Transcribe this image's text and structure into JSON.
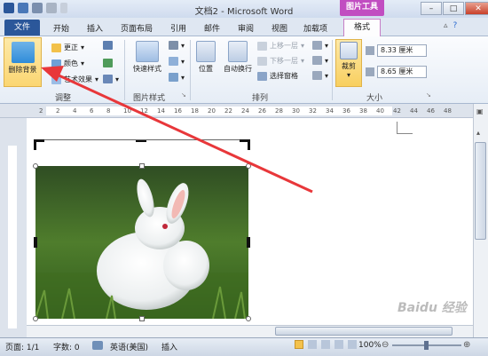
{
  "window": {
    "title": "文档2 - Microsoft Word",
    "context_group": "图片工具"
  },
  "tabs": {
    "file": "文件",
    "home": "开始",
    "insert": "插入",
    "layout": "页面布局",
    "references": "引用",
    "mailings": "邮件",
    "review": "审阅",
    "view": "视图",
    "addins": "加载项",
    "format": "格式"
  },
  "ribbon": {
    "adjust": {
      "remove_bg": "删除背景",
      "corrections": "更正",
      "color": "颜色",
      "effects": "艺术效果",
      "label": "调整"
    },
    "styles": {
      "quick_styles": "快速样式",
      "label": "图片样式"
    },
    "arrange": {
      "position": "位置",
      "wrap": "自动换行",
      "bring_forward": "上移一层",
      "send_backward": "下移一层",
      "selection_pane": "选择窗格",
      "label": "排列"
    },
    "size": {
      "crop": "裁剪",
      "height": "8.33 厘米",
      "width": "8.65 厘米",
      "label": "大小"
    }
  },
  "ruler": {
    "ticks": [
      "2",
      "2",
      "4",
      "6",
      "8",
      "10",
      "12",
      "14",
      "16",
      "18",
      "20",
      "22",
      "24",
      "26",
      "28",
      "30",
      "32",
      "34",
      "36",
      "38",
      "40",
      "42",
      "44",
      "46",
      "48"
    ]
  },
  "status": {
    "page": "页面: 1/1",
    "words": "字数: 0",
    "language": "英语(美国)",
    "insert": "插入",
    "zoom": "100%"
  },
  "watermark": "Baidu 经验"
}
